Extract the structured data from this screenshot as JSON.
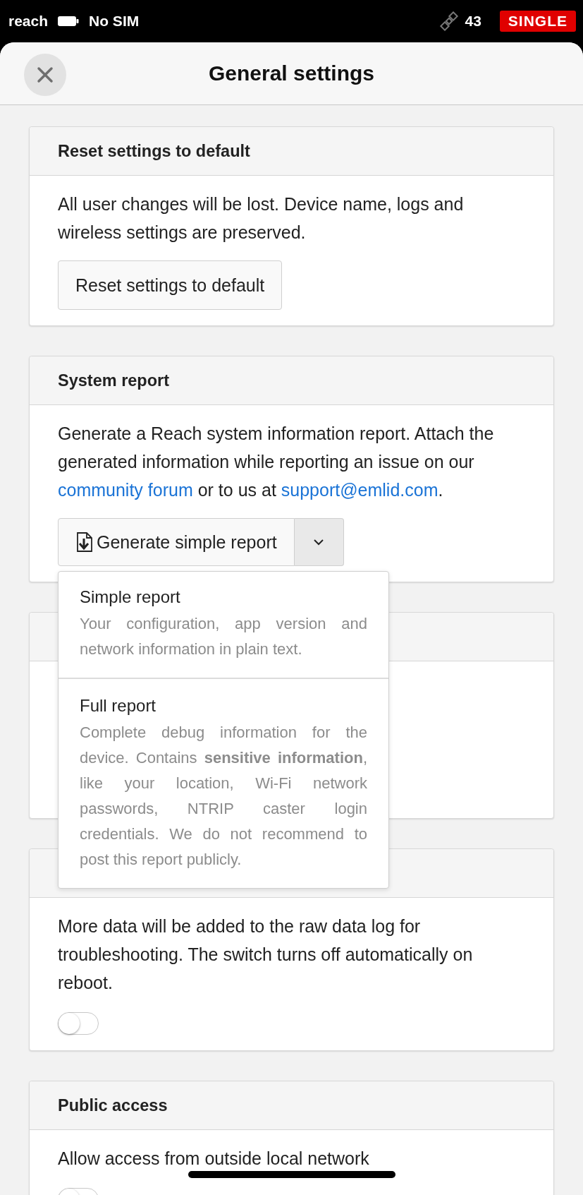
{
  "status_bar": {
    "device": "reach",
    "network": "No SIM",
    "satellites": "43",
    "solution": "SINGLE"
  },
  "header": {
    "title": "General settings"
  },
  "cards": [
    {
      "kind": "reset",
      "title": "Reset settings to default",
      "text": [
        {
          "text": "All user changes will be lost. Device name, logs and wireless settings are preserved."
        }
      ],
      "button": "Reset settings to default"
    },
    {
      "kind": "report",
      "title": "System report",
      "text": [
        {
          "text": "Generate a Reach system information report. Attach the generated information while reporting an issue on our "
        },
        {
          "text": "community forum",
          "link": true
        },
        {
          "text": " or to us at "
        },
        {
          "text": "support@emlid.com",
          "link": true
        },
        {
          "text": "."
        }
      ],
      "button": "Generate simple report",
      "menu": {
        "expanded": true,
        "items": [
          {
            "title": "Simple report",
            "description": "Your configuration, app version and network information in plain text."
          },
          {
            "title": "Full report",
            "description": "Complete debug information for the device. Contains **sensitive information**, like your location, Wi-Fi network passwords, NTRIP caster login credentials. We do not recommend to post this report publicly."
          }
        ]
      }
    },
    {
      "kind": "blank"
    },
    {
      "kind": "toggle",
      "text": [
        {
          "text": "More data will be added to the raw data log for troubleshooting. The switch turns off automatically on reboot."
        }
      ],
      "switch": {
        "on": false
      }
    },
    {
      "kind": "toggle",
      "title": "Public access",
      "text": [
        {
          "text": "Allow access from outside local network"
        }
      ],
      "switch": {
        "on": false
      }
    }
  ]
}
